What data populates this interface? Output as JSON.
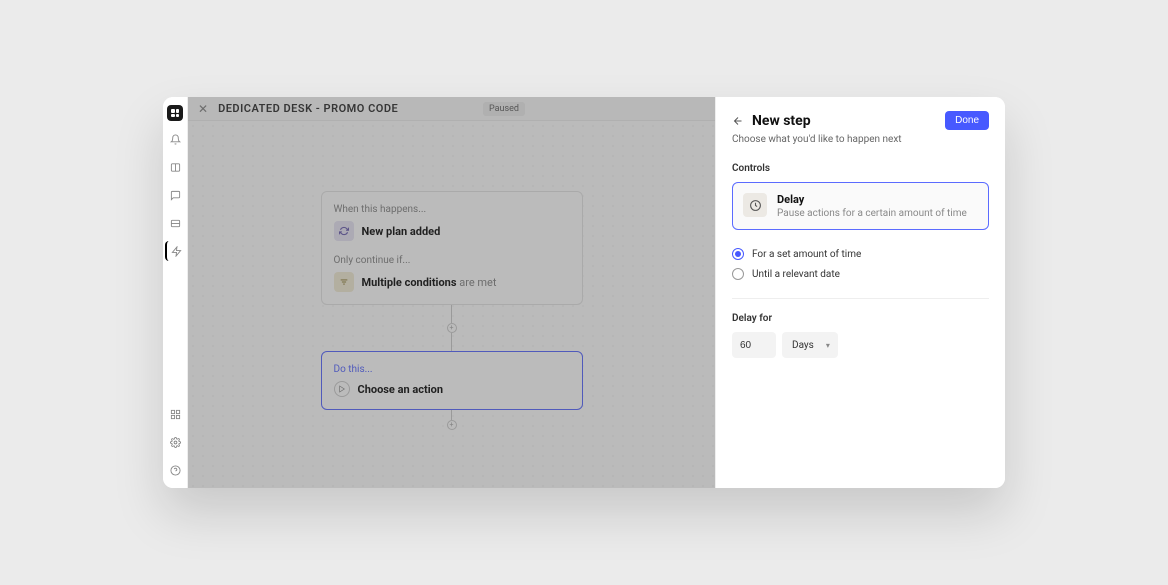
{
  "header": {
    "title": "DEDICATED DESK - PROMO CODE",
    "status": "Paused"
  },
  "flow": {
    "trigger_label": "When this happens...",
    "trigger_text": "New plan added",
    "condition_label": "Only continue if...",
    "condition_bold": "Multiple conditions",
    "condition_rest": " are met",
    "action_label": "Do this...",
    "action_text": "Choose an action"
  },
  "panel": {
    "title": "New step",
    "subtitle": "Choose what you'd like to happen next",
    "done": "Done",
    "controls_label": "Controls",
    "delay_title": "Delay",
    "delay_desc": "Pause actions for a certain amount of time",
    "radio_set_amount": "For a set amount of time",
    "radio_relevant_date": "Until a relevant date",
    "delay_for_label": "Delay for",
    "delay_value": "60",
    "delay_unit": "Days"
  }
}
